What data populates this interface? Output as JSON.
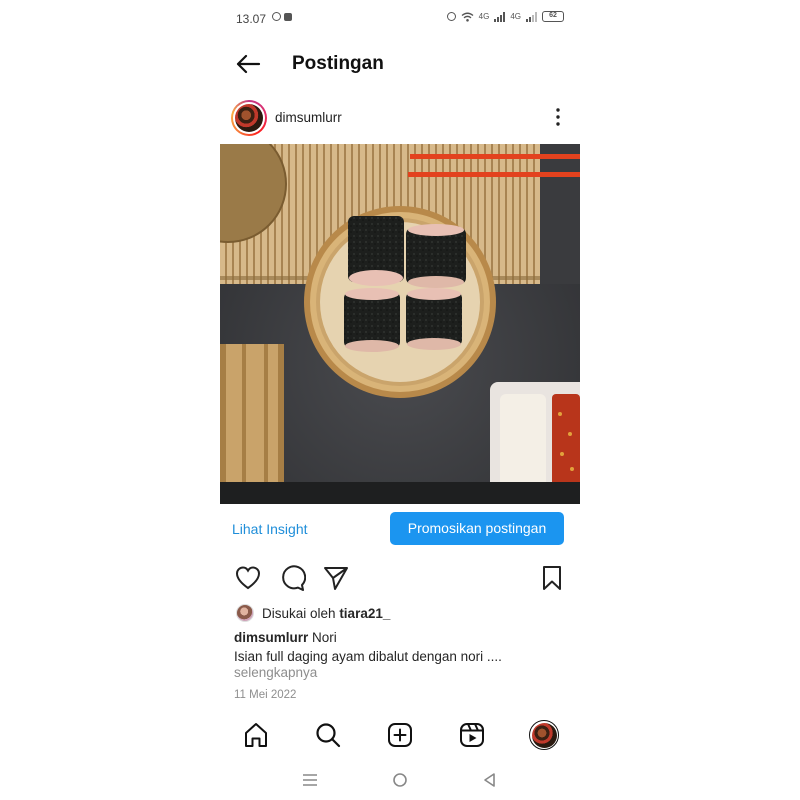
{
  "status_bar": {
    "time": "13.07",
    "battery": "62",
    "network_1": "4G",
    "network_2": "4G",
    "icons": [
      "whatsapp-icon",
      "message-icon",
      "alarm-icon",
      "wifi-icon",
      "signal-icon",
      "signal-icon",
      "battery-icon"
    ]
  },
  "header": {
    "title": "Postingan",
    "back_icon": "arrow-left-icon"
  },
  "post": {
    "username": "dimsumlurr",
    "more_icon": "more-vertical-icon",
    "image_description_icon": "dimsum-photo"
  },
  "insight": {
    "link_label": "Lihat Insight",
    "promote_label": "Promosikan postingan",
    "promote_color": "#1b95f0"
  },
  "actions": {
    "icons": [
      "heart-icon",
      "comment-icon",
      "send-icon",
      "bookmark-icon"
    ]
  },
  "likes": {
    "prefix": "Disukai oleh",
    "user": "tiara21_"
  },
  "caption": {
    "user": "dimsumlurr",
    "title": "Nori",
    "text": "Isian full daging ayam dibalut dengan nori ....",
    "more_label": "selengkapnya",
    "date": "11 Mei 2022"
  },
  "bottom_nav": {
    "icons": [
      "home-icon",
      "search-icon",
      "add-icon",
      "reels-icon",
      "profile-icon"
    ]
  },
  "system_nav": {
    "icons": [
      "menu-icon",
      "home-circle-icon",
      "back-triangle-icon"
    ]
  }
}
